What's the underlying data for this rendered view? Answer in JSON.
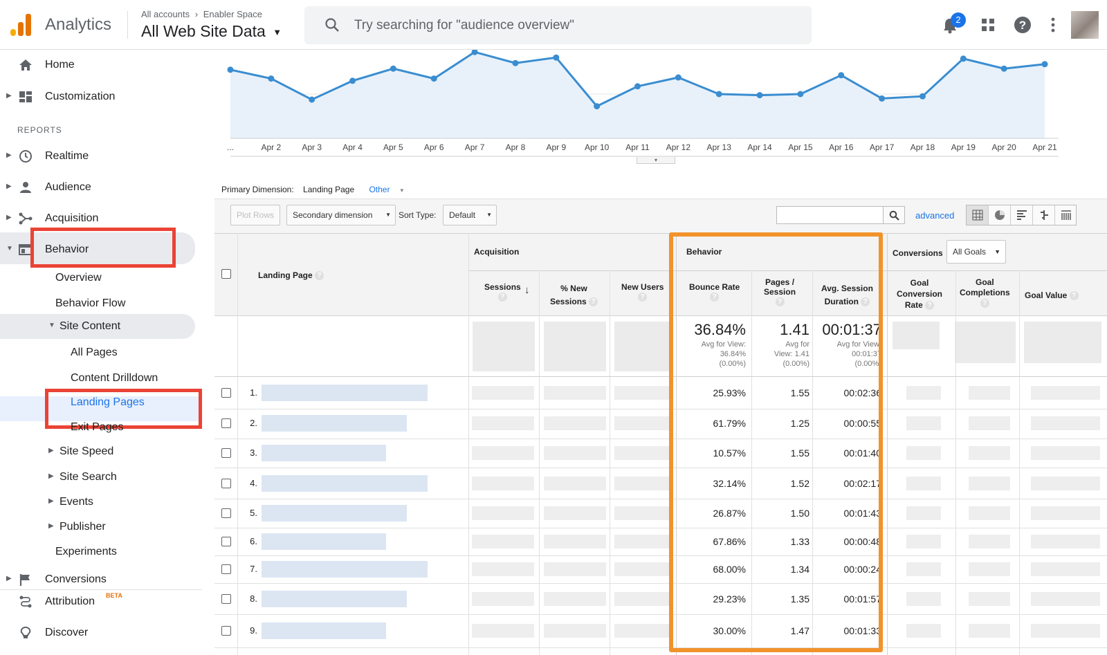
{
  "header": {
    "app_name": "Analytics",
    "account_crumb": "All accounts",
    "account_name": "Enabler Space",
    "property_view": "All Web Site Data",
    "search_placeholder": "Try searching for \"audience overview\"",
    "notification_count": "2"
  },
  "sidebar": {
    "home": "Home",
    "customization": "Customization",
    "reports_title": "REPORTS",
    "realtime": "Realtime",
    "audience": "Audience",
    "acquisition": "Acquisition",
    "behavior": "Behavior",
    "overview": "Overview",
    "behavior_flow": "Behavior Flow",
    "site_content": "Site Content",
    "all_pages": "All Pages",
    "content_drilldown": "Content Drilldown",
    "landing_pages": "Landing Pages",
    "exit_pages": "Exit Pages",
    "site_speed": "Site Speed",
    "site_search": "Site Search",
    "events": "Events",
    "publisher": "Publisher",
    "experiments": "Experiments",
    "conversions": "Conversions",
    "attribution": "Attribution",
    "attribution_badge": "BETA",
    "discover": "Discover"
  },
  "chart_data": {
    "type": "line",
    "x": [
      "...",
      "Apr 2",
      "Apr 3",
      "Apr 4",
      "Apr 5",
      "Apr 6",
      "Apr 7",
      "Apr 8",
      "Apr 9",
      "Apr 10",
      "Apr 11",
      "Apr 12",
      "Apr 13",
      "Apr 14",
      "Apr 15",
      "Apr 16",
      "Apr 17",
      "Apr 18",
      "Apr 19",
      "Apr 20",
      "Apr 21"
    ],
    "values": [
      62,
      54,
      35,
      52,
      63,
      54,
      78,
      68,
      73,
      29,
      47,
      55,
      40,
      39,
      40,
      57,
      36,
      38,
      72,
      63,
      67
    ],
    "ylim": [
      0,
      80
    ],
    "grid": true,
    "color": "#3a8dd0"
  },
  "dimension": {
    "primary_label": "Primary Dimension:",
    "primary_value": "Landing Page",
    "other": "Other"
  },
  "toolbar": {
    "plot_rows": "Plot Rows",
    "secondary_dimension": "Secondary dimension",
    "sort_type_label": "Sort Type:",
    "sort_default": "Default",
    "advanced": "advanced"
  },
  "table": {
    "landing_page_header": "Landing Page",
    "acquisition_header": "Acquisition",
    "behavior_header": "Behavior",
    "conversions_header": "Conversions",
    "goals_select": "All Goals",
    "columns": {
      "sessions": "Sessions",
      "pct_new_sessions_1": "% New",
      "pct_new_sessions_2": "Sessions",
      "new_users": "New Users",
      "bounce_rate": "Bounce Rate",
      "pages_session_1": "Pages /",
      "pages_session_2": "Session",
      "avg_duration_1": "Avg. Session",
      "avg_duration_2": "Duration",
      "goal_conv_1": "Goal",
      "goal_conv_2": "Conversion",
      "goal_conv_3": "Rate",
      "goal_comp_1": "Goal",
      "goal_comp_2": "Completions",
      "goal_value": "Goal Value"
    },
    "totals": {
      "bounce_rate": "36.84%",
      "bounce_sub1": "Avg for View:",
      "bounce_sub2": "36.84%",
      "bounce_sub3": "(0.00%)",
      "pages": "1.41",
      "pages_sub1": "Avg for",
      "pages_sub2": "View: 1.41",
      "pages_sub3": "(0.00%)",
      "duration": "00:01:37",
      "duration_sub1": "Avg for View:",
      "duration_sub2": "00:01:37",
      "duration_sub3": "(0.00%)"
    },
    "rows": [
      {
        "n": "1.",
        "bounce": "25.93%",
        "pages": "1.55",
        "dur": "00:02:36"
      },
      {
        "n": "2.",
        "bounce": "61.79%",
        "pages": "1.25",
        "dur": "00:00:55"
      },
      {
        "n": "3.",
        "bounce": "10.57%",
        "pages": "1.55",
        "dur": "00:01:40"
      },
      {
        "n": "4.",
        "bounce": "32.14%",
        "pages": "1.52",
        "dur": "00:02:17"
      },
      {
        "n": "5.",
        "bounce": "26.87%",
        "pages": "1.50",
        "dur": "00:01:43"
      },
      {
        "n": "6.",
        "bounce": "67.86%",
        "pages": "1.33",
        "dur": "00:00:48"
      },
      {
        "n": "7.",
        "bounce": "68.00%",
        "pages": "1.34",
        "dur": "00:00:24"
      },
      {
        "n": "8.",
        "bounce": "29.23%",
        "pages": "1.35",
        "dur": "00:01:57"
      },
      {
        "n": "9.",
        "bounce": "30.00%",
        "pages": "1.47",
        "dur": "00:01:33"
      }
    ]
  }
}
